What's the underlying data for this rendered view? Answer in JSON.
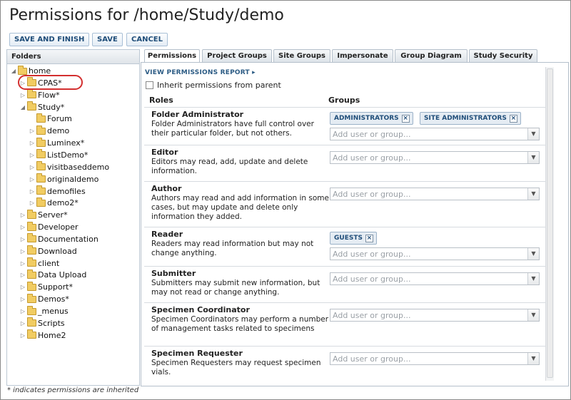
{
  "page": {
    "title": "Permissions for /home/Study/demo"
  },
  "toolbar": {
    "save_finish": "SAVE AND FINISH",
    "save": "SAVE",
    "cancel": "CANCEL"
  },
  "folders": {
    "header": "Folders",
    "items": [
      {
        "label": "home",
        "expanded": true
      },
      {
        "label": "CPAS*"
      },
      {
        "label": "Flow*"
      },
      {
        "label": "Study*",
        "expanded": true
      },
      {
        "label": "Forum"
      },
      {
        "label": "demo",
        "selected": true
      },
      {
        "label": "Luminex*"
      },
      {
        "label": "ListDemo*"
      },
      {
        "label": "visitbaseddemo"
      },
      {
        "label": "originaldemo"
      },
      {
        "label": "demofiles"
      },
      {
        "label": "demo2*"
      },
      {
        "label": "Server*"
      },
      {
        "label": "Developer"
      },
      {
        "label": "Documentation"
      },
      {
        "label": "Download"
      },
      {
        "label": "client"
      },
      {
        "label": "Data Upload"
      },
      {
        "label": "Support*"
      },
      {
        "label": "Demos*"
      },
      {
        "label": "_menus"
      },
      {
        "label": "Scripts"
      },
      {
        "label": "Home2"
      }
    ],
    "footnote": "* indicates permissions are inherited"
  },
  "tabs": [
    "Permissions",
    "Project Groups",
    "Site Groups",
    "Impersonate",
    "Group Diagram",
    "Study Security"
  ],
  "permissions": {
    "view_report": "VIEW PERMISSIONS REPORT",
    "inherit_label": "Inherit permissions from parent",
    "roles_header": "Roles",
    "groups_header": "Groups",
    "placeholder": "Add user or group...",
    "roles": [
      {
        "name": "Folder Administrator",
        "desc": "Folder Administrators have full control over their particular folder, but not others.",
        "groups": [
          "ADMINISTRATORS",
          "SITE ADMINISTRATORS"
        ]
      },
      {
        "name": "Editor",
        "desc": "Editors may read, add, update and delete information.",
        "groups": []
      },
      {
        "name": "Author",
        "desc": "Authors may read and add information in some cases, but may update and delete only information they added.",
        "groups": []
      },
      {
        "name": "Reader",
        "desc": "Readers may read information but may not change anything.",
        "groups": [
          "GUESTS"
        ]
      },
      {
        "name": "Submitter",
        "desc": "Submitters may submit new information, but may not read or change anything.",
        "groups": []
      },
      {
        "name": "Specimen Coordinator",
        "desc": "Specimen Coordinators may perform a number of management tasks related to specimens",
        "groups": []
      },
      {
        "name": "Specimen Requester",
        "desc": "Specimen Requesters may request specimen vials.",
        "groups": []
      }
    ]
  }
}
